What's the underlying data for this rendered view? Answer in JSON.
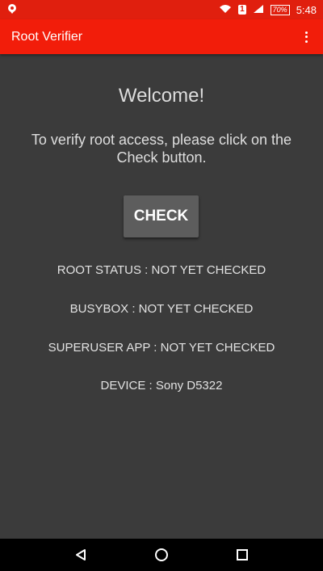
{
  "status_bar": {
    "battery": "70%",
    "time": "5:48",
    "notification_count": "1"
  },
  "app_bar": {
    "title": "Root Verifier",
    "menu_icon": "more-vert-icon"
  },
  "main": {
    "welcome": "Welcome!",
    "instruction": "To verify root access, please click on the Check button.",
    "check_button": "CHECK",
    "root_status": "ROOT STATUS : NOT YET CHECKED",
    "busybox": "BUSYBOX : NOT YET CHECKED",
    "superuser_app": "SUPERUSER APP : NOT YET CHECKED",
    "device": "DEVICE : Sony D5322"
  },
  "colors": {
    "status_bar": "#e01f0e",
    "app_bar": "#f21d0a",
    "background": "#3b3b3b",
    "button": "#5d5d5d"
  }
}
